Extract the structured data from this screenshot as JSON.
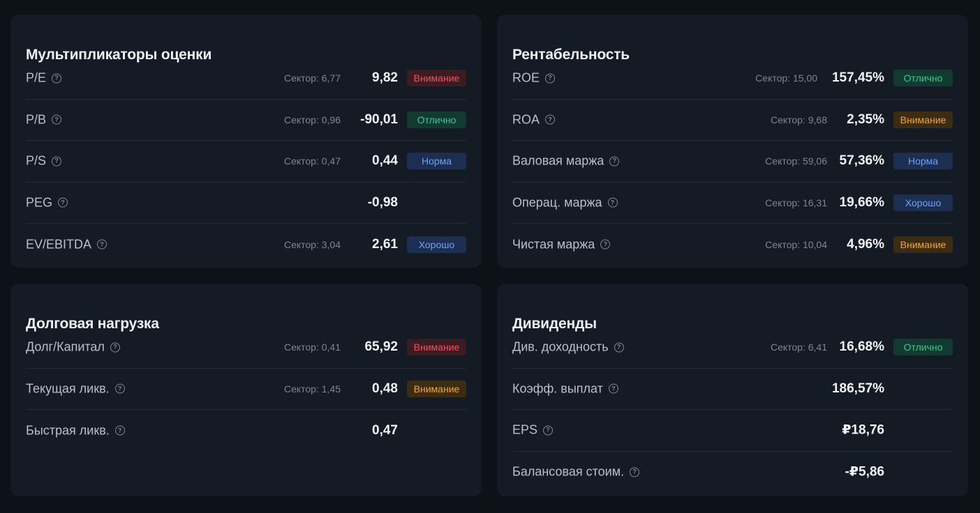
{
  "cards": [
    {
      "title": "Мультипликаторы оценки",
      "rows": [
        {
          "label": "P/E",
          "sector": "Сектор: 6,77",
          "value": "9,82",
          "badge": "Внимание",
          "badge_type": "warn"
        },
        {
          "label": "P/B",
          "sector": "Сектор: 0,96",
          "value": "-90,01",
          "badge": "Отлично",
          "badge_type": "good"
        },
        {
          "label": "P/S",
          "sector": "Сектор: 0,47",
          "value": "0,44",
          "badge": "Норма",
          "badge_type": "norm"
        },
        {
          "label": "PEG",
          "sector": "",
          "value": "-0,98",
          "badge": "",
          "badge_type": "empty"
        },
        {
          "label": "EV/EBITDA",
          "sector": "Сектор: 3,04",
          "value": "2,61",
          "badge": "Хорошо",
          "badge_type": "fine"
        }
      ]
    },
    {
      "title": "Рентабельность",
      "rows": [
        {
          "label": "ROE",
          "sector": "Сектор: 15,00",
          "value": "157,45%",
          "badge": "Отлично",
          "badge_type": "good"
        },
        {
          "label": "ROA",
          "sector": "Сектор: 9,68",
          "value": "2,35%",
          "badge": "Внимание",
          "badge_type": "amber"
        },
        {
          "label": "Валовая маржа",
          "sector": "Сектор: 59,06",
          "value": "57,36%",
          "badge": "Норма",
          "badge_type": "norm"
        },
        {
          "label": "Операц. маржа",
          "sector": "Сектор: 16,31",
          "value": "19,66%",
          "badge": "Хорошо",
          "badge_type": "fine"
        },
        {
          "label": "Чистая маржа",
          "sector": "Сектор: 10,04",
          "value": "4,96%",
          "badge": "Внимание",
          "badge_type": "amber"
        }
      ]
    },
    {
      "title": "Долговая нагрузка",
      "rows": [
        {
          "label": "Долг/Капитал",
          "sector": "Сектор: 0,41",
          "value": "65,92",
          "badge": "Внимание",
          "badge_type": "warn"
        },
        {
          "label": "Текущая ликв.",
          "sector": "Сектор: 1,45",
          "value": "0,48",
          "badge": "Внимание",
          "badge_type": "amber"
        },
        {
          "label": "Быстрая ликв.",
          "sector": "",
          "value": "0,47",
          "badge": "",
          "badge_type": "empty"
        }
      ]
    },
    {
      "title": "Дивиденды",
      "rows": [
        {
          "label": "Див. доходность",
          "sector": "Сектор: 6,41",
          "value": "16,68%",
          "badge": "Отлично",
          "badge_type": "good"
        },
        {
          "label": "Коэфф. выплат",
          "sector": "",
          "value": "186,57%",
          "badge": "",
          "badge_type": "empty"
        },
        {
          "label": "EPS",
          "sector": "",
          "value": "₽18,76",
          "badge": "",
          "badge_type": "empty"
        },
        {
          "label": "Балансовая стоим.",
          "sector": "",
          "value": "-₽5,86",
          "badge": "",
          "badge_type": "empty"
        }
      ]
    }
  ],
  "icons": {
    "help": "question-circle-icon",
    "help_glyph": "?"
  },
  "colors": {
    "background": "#0d1118",
    "card": "#151b25",
    "warn": "#f0525c",
    "good": "#3cc990",
    "norm": "#6ea2f2",
    "amber": "#f2a534"
  }
}
